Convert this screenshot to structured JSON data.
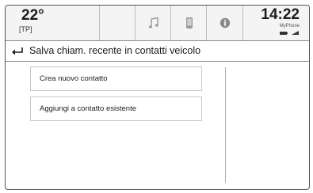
{
  "status_bar": {
    "temperature": "22°",
    "temperature_source": "[TP]",
    "tabs": [
      {
        "icon": "music-note-icon"
      },
      {
        "icon": "phone-icon"
      },
      {
        "icon": "info-icon"
      }
    ],
    "clock": "14:22",
    "phone_name": "MyPhone"
  },
  "header": {
    "back_icon": "back-arrow-icon",
    "title": "Salva chiam. recente in contatti veicolo"
  },
  "options": [
    {
      "label": "Crea nuovo contatto"
    },
    {
      "label": "Aggiungi a contatto esistente"
    }
  ]
}
